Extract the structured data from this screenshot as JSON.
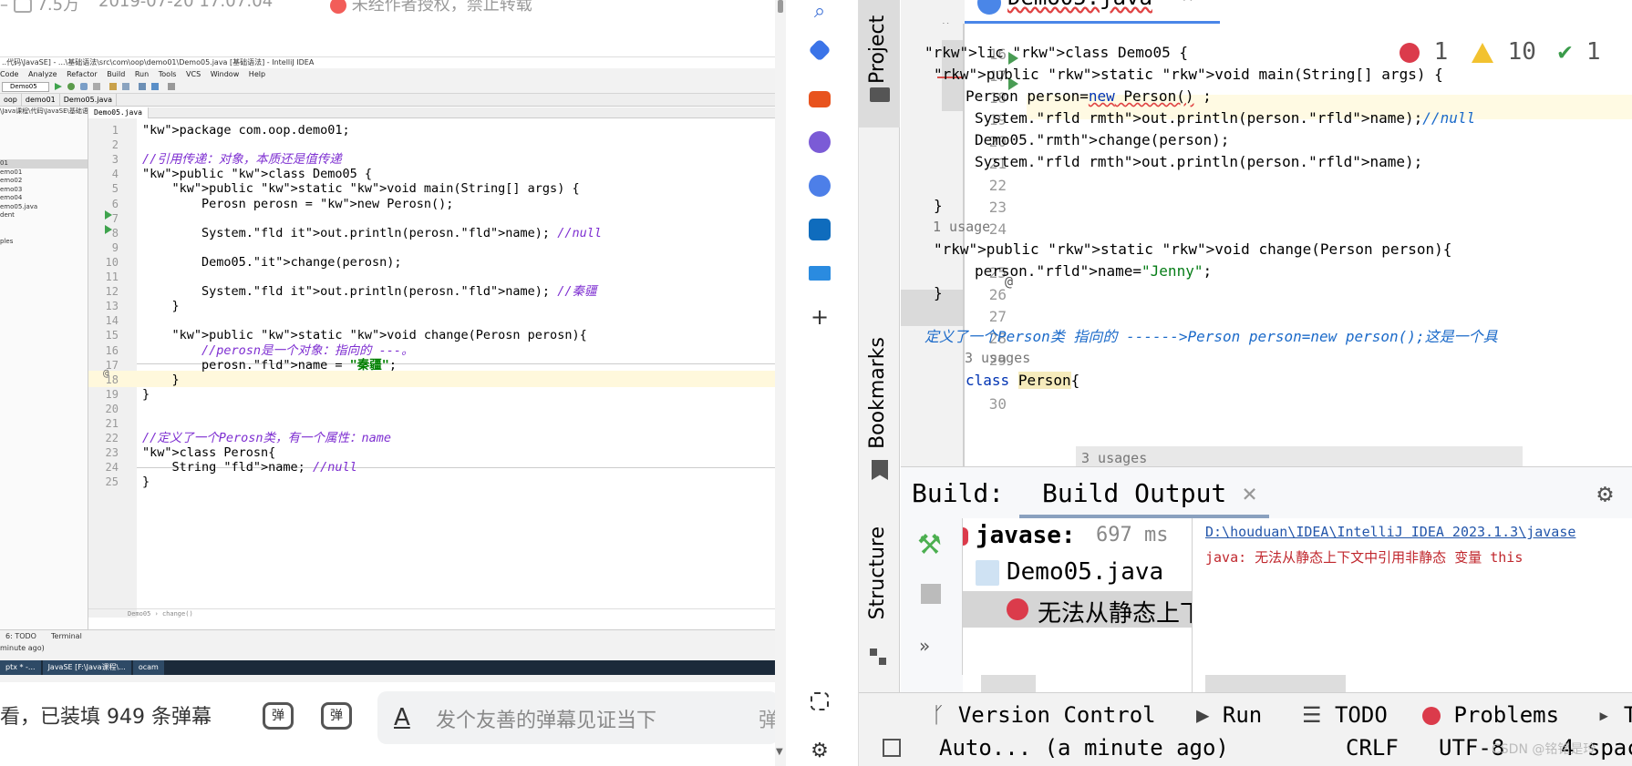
{
  "video": {
    "top_bar": {
      "icon_text": "7.5万",
      "date": "2019-07-20 17:07:04",
      "notice": "未经作者授权，禁止转载"
    },
    "ide": {
      "title": "..代码\\JavaSE] - ...\\基础语法\\src\\com\\oop\\demo01\\Demo05.java [基础语法] - IntelliJ IDEA",
      "menu": [
        "Code",
        "Analyze",
        "Refactor",
        "Build",
        "Run",
        "Tools",
        "VCS",
        "Window",
        "Help"
      ],
      "config": "Demo05",
      "crumbs": [
        "oop",
        "demo01",
        "Demo05.java"
      ],
      "tab": "Demo05.java",
      "project_tree": [
        "\\Java课程\\代码\\JavaSE\\基础语",
        "",
        "",
        "",
        "",
        "",
        "01",
        "emo01",
        "emo02",
        "emo03",
        "emo04",
        "emo05.java",
        "dent",
        "",
        "",
        "ples"
      ],
      "lines": [
        {
          "n": "1",
          "t": "package com.oop.demo01;"
        },
        {
          "n": "2",
          "t": ""
        },
        {
          "n": "3",
          "t": "//引用传递：对象，本质还是值传递"
        },
        {
          "n": "4",
          "t": "public class Demo05 {"
        },
        {
          "n": "5",
          "t": "    public static void main(String[] args) {"
        },
        {
          "n": "6",
          "t": "        Perosn perosn = new Perosn();"
        },
        {
          "n": "7",
          "t": ""
        },
        {
          "n": "8",
          "t": "        System.out.println(perosn.name); //null"
        },
        {
          "n": "9",
          "t": ""
        },
        {
          "n": "10",
          "t": "        Demo05.change(perosn);"
        },
        {
          "n": "11",
          "t": ""
        },
        {
          "n": "12",
          "t": "        System.out.println(perosn.name); //秦疆"
        },
        {
          "n": "13",
          "t": "    }"
        },
        {
          "n": "14",
          "t": ""
        },
        {
          "n": "15",
          "t": "    public static void change(Perosn perosn){"
        },
        {
          "n": "16",
          "t": "        //perosn是一个对象：指向的 ---。"
        },
        {
          "n": "17",
          "t": "        perosn.name = \"秦疆\";"
        },
        {
          "n": "18",
          "t": "    }"
        },
        {
          "n": "19",
          "t": "}"
        },
        {
          "n": "20",
          "t": ""
        },
        {
          "n": "21",
          "t": ""
        },
        {
          "n": "22",
          "t": "//定义了一个Perosn类，有一个属性：name"
        },
        {
          "n": "23",
          "t": "class Perosn{"
        },
        {
          "n": "24",
          "t": "    String name; //null"
        },
        {
          "n": "25",
          "t": "}"
        }
      ],
      "editor_crumb": [
        "Demo05",
        "change()"
      ],
      "bottom_tabs": [
        "6: TODO",
        "Terminal"
      ],
      "status": "minute ago)",
      "taskbar": [
        "ptx * -...",
        "JavaSE [F:\\Java课程\\...",
        "ocam"
      ]
    },
    "danmaku": {
      "count_text": "看，已装填 949 条弹幕",
      "input_placeholder": "发个友善的弹幕见证当下",
      "send_label": "弹"
    }
  },
  "right_ide": {
    "sidebar_labels": {
      "project": "Project",
      "bookmarks": "Bookmarks",
      "structure": "Structure"
    },
    "tab": "Demo05.java",
    "inspections": {
      "errors": "1",
      "warnings": "10",
      "ok": "1"
    },
    "lines": [
      {
        "n": "16"
      },
      {
        "n": "17",
        "code": "lic class Demo05 {"
      },
      {
        "n": "18",
        "code": "public static void main(String[] args) {"
      },
      {
        "n": "19",
        "code": "Person person=new Person() ;"
      },
      {
        "n": "20",
        "code": "System.out.println(person.name);//null"
      },
      {
        "n": "21",
        "code": "Demo05.change(person);"
      },
      {
        "n": "22",
        "code": "System.out.println(person.name);"
      },
      {
        "n": "23"
      },
      {
        "n": "24",
        "code": "}"
      },
      {
        "usage": "1 usage"
      },
      {
        "n": "25",
        "code": "public static void change(Person person){"
      },
      {
        "n": "26",
        "code": "person.name=\"Jenny\";"
      },
      {
        "n": "27",
        "code": "}"
      },
      {
        "n": "28"
      },
      {
        "n": "29",
        "code": "定义了一个Person类 指向的 ------>Person person=new person();这是一个具"
      },
      {
        "usage": "3 usages"
      },
      {
        "n": "30",
        "code": "class Person{"
      },
      {
        "usage": "3 usages"
      }
    ],
    "build": {
      "label": "Build:",
      "tab": "Build Output",
      "tree": [
        {
          "name": "javase:",
          "time": "697 ms"
        },
        {
          "name": "Demo05.java"
        },
        {
          "name": "无法从静态上下"
        }
      ],
      "output_link": "D:\\houduan\\IDEA\\IntelliJ IDEA 2023.1.3\\javase",
      "output_error": "java: 无法从静态上下文中引用非静态 变量 this"
    },
    "bottom_tabs": [
      "Version Control",
      "Run",
      "TODO",
      "Problems",
      "T"
    ],
    "status": [
      "Auto... (a minute ago)",
      "CRLF",
      "UTF-8",
      "4 spac"
    ],
    "watermark": "CSDN @铭铭是玲"
  }
}
